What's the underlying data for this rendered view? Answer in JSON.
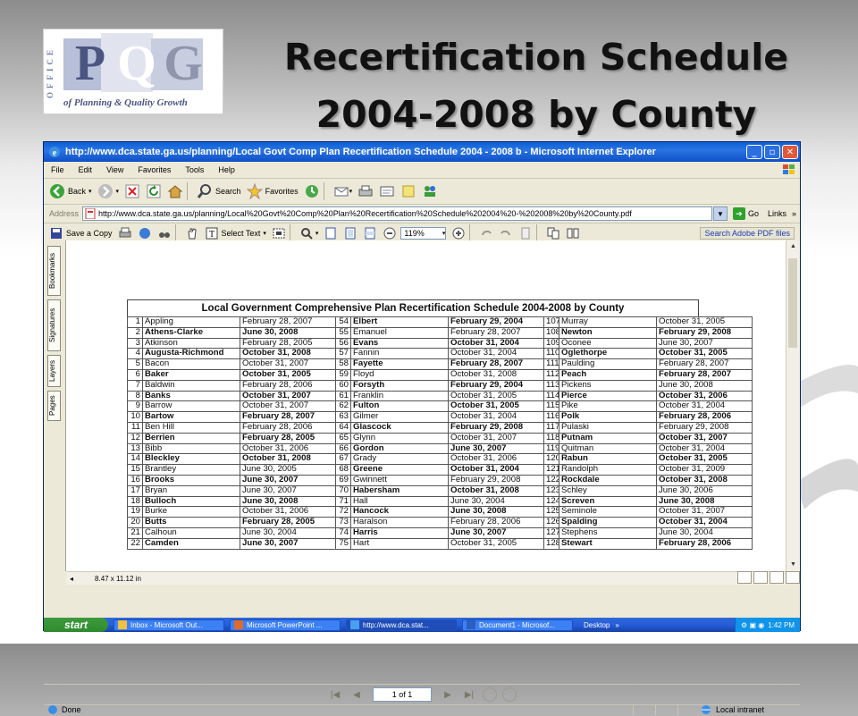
{
  "slide": {
    "title_line1": "Recertification Schedule",
    "title_line2": "2004-2008 by County",
    "logo": {
      "office": "OFFICE",
      "letters": [
        "P",
        "Q",
        "G"
      ],
      "tagline": "of Planning & Quality Growth"
    }
  },
  "browser": {
    "title": "http://www.dca.state.ga.us/planning/Local Govt Comp Plan Recertification Schedule 2004 - 2008 b - Microsoft Internet Explorer",
    "menu": [
      "File",
      "Edit",
      "View",
      "Favorites",
      "Tools",
      "Help"
    ],
    "toolbar": {
      "back": "Back",
      "search": "Search",
      "favorites": "Favorites"
    },
    "address_label": "Address",
    "address_value": "http://www.dca.state.ga.us/planning/Local%20Govt%20Comp%20Plan%20Recertification%20Schedule%202004%20-%202008%20by%20County.pdf",
    "go": "Go",
    "links": "Links"
  },
  "pdf_toolbar": {
    "save_copy": "Save a Copy",
    "select_text": "Select Text",
    "zoom": "119%",
    "search_adobe": "Search Adobe PDF files"
  },
  "side_tabs": [
    "Bookmarks",
    "Signatures",
    "Layers",
    "Pages"
  ],
  "page_size": "8.47 x 11.12 in",
  "page_nav": "1 of 1",
  "status": {
    "left": "Done",
    "zone": "Local intranet"
  },
  "taskbar": {
    "start": "start",
    "tasks": [
      "Inbox - Microsoft Out...",
      "Microsoft PowerPoint ...",
      "http://www.dca.stat...",
      "Document1 - Microsof..."
    ],
    "desktop": "Desktop",
    "clock": "1:42 PM"
  },
  "schedule": {
    "title": "Local Government Comprehensive Plan Recertification Schedule 2004-2008 by County",
    "rows": [
      {
        "b": false,
        "c": [
          [
            "1",
            "Appling",
            "February 28, 2007"
          ],
          [
            "54",
            "Elbert",
            "February 29, 2004"
          ],
          [
            "107",
            "Murray",
            "October 31, 2005"
          ]
        ],
        "bold": [
          false,
          true,
          false
        ]
      },
      {
        "c": [
          [
            "2",
            "Athens-Clarke",
            "June 30, 2008"
          ],
          [
            "55",
            "Emanuel",
            "February 28, 2007"
          ],
          [
            "108",
            "Newton",
            "February 29, 2008"
          ]
        ],
        "bold": [
          true,
          false,
          true
        ]
      },
      {
        "c": [
          [
            "3",
            "Atkinson",
            "February 28, 2005"
          ],
          [
            "56",
            "Evans",
            "October 31, 2004"
          ],
          [
            "109",
            "Oconee",
            "June 30, 2007"
          ]
        ],
        "bold": [
          false,
          true,
          false
        ]
      },
      {
        "c": [
          [
            "4",
            "Augusta-Richmond",
            "October 31, 2008"
          ],
          [
            "57",
            "Fannin",
            "October 31, 2004"
          ],
          [
            "110",
            "Oglethorpe",
            "October 31, 2005"
          ]
        ],
        "bold": [
          true,
          false,
          true
        ]
      },
      {
        "c": [
          [
            "5",
            "Bacon",
            "October 31, 2007"
          ],
          [
            "58",
            "Fayette",
            "February 28, 2007"
          ],
          [
            "111",
            "Paulding",
            "February 28, 2007"
          ]
        ],
        "bold": [
          false,
          true,
          false
        ]
      },
      {
        "c": [
          [
            "6",
            "Baker",
            "October 31, 2005"
          ],
          [
            "59",
            "Floyd",
            "October 31, 2008"
          ],
          [
            "112",
            "Peach",
            "February 28, 2007"
          ]
        ],
        "bold": [
          true,
          false,
          true
        ]
      },
      {
        "c": [
          [
            "7",
            "Baldwin",
            "February 28, 2006"
          ],
          [
            "60",
            "Forsyth",
            "February 29, 2004"
          ],
          [
            "113",
            "Pickens",
            "June 30, 2008"
          ]
        ],
        "bold": [
          false,
          true,
          false
        ]
      },
      {
        "c": [
          [
            "8",
            "Banks",
            "October 31, 2007"
          ],
          [
            "61",
            "Franklin",
            "October 31, 2005"
          ],
          [
            "114",
            "Pierce",
            "October 31, 2006"
          ]
        ],
        "bold": [
          true,
          false,
          true
        ]
      },
      {
        "c": [
          [
            "9",
            "Barrow",
            "October 31, 2007"
          ],
          [
            "62",
            "Fulton",
            "October 31, 2005"
          ],
          [
            "115",
            "Pike",
            "October 31, 2004"
          ]
        ],
        "bold": [
          false,
          true,
          false
        ]
      },
      {
        "c": [
          [
            "10",
            "Bartow",
            "February 28, 2007"
          ],
          [
            "63",
            "Gilmer",
            "October 31, 2004"
          ],
          [
            "116",
            "Polk",
            "February 28, 2006"
          ]
        ],
        "bold": [
          true,
          false,
          true
        ]
      },
      {
        "c": [
          [
            "11",
            "Ben Hill",
            "February 28, 2006"
          ],
          [
            "64",
            "Glascock",
            "February 29, 2008"
          ],
          [
            "117",
            "Pulaski",
            "February 29, 2008"
          ]
        ],
        "bold": [
          false,
          true,
          false
        ]
      },
      {
        "c": [
          [
            "12",
            "Berrien",
            "February 28, 2005"
          ],
          [
            "65",
            "Glynn",
            "October 31, 2007"
          ],
          [
            "118",
            "Putnam",
            "October 31, 2007"
          ]
        ],
        "bold": [
          true,
          false,
          true
        ]
      },
      {
        "c": [
          [
            "13",
            "Bibb",
            "October 31, 2006"
          ],
          [
            "66",
            "Gordon",
            "June 30, 2007"
          ],
          [
            "119",
            "Quitman",
            "October 31, 2004"
          ]
        ],
        "bold": [
          false,
          true,
          false
        ]
      },
      {
        "c": [
          [
            "14",
            "Bleckley",
            "October 31, 2008"
          ],
          [
            "67",
            "Grady",
            "October 31, 2006"
          ],
          [
            "120",
            "Rabun",
            "October 31, 2005"
          ]
        ],
        "bold": [
          true,
          false,
          true
        ]
      },
      {
        "c": [
          [
            "15",
            "Brantley",
            "June 30, 2005"
          ],
          [
            "68",
            "Greene",
            "October 31, 2004"
          ],
          [
            "121",
            "Randolph",
            "October 31, 2009"
          ]
        ],
        "bold": [
          false,
          true,
          false
        ]
      },
      {
        "c": [
          [
            "16",
            "Brooks",
            "June 30, 2007"
          ],
          [
            "69",
            "Gwinnett",
            "February 29, 2008"
          ],
          [
            "122",
            "Rockdale",
            "October 31, 2008"
          ]
        ],
        "bold": [
          true,
          false,
          true
        ]
      },
      {
        "c": [
          [
            "17",
            "Bryan",
            "June 30, 2007"
          ],
          [
            "70",
            "Habersham",
            "October 31, 2008"
          ],
          [
            "123",
            "Schley",
            "June 30, 2006"
          ]
        ],
        "bold": [
          false,
          true,
          false
        ]
      },
      {
        "c": [
          [
            "18",
            "Bulloch",
            "June 30, 2008"
          ],
          [
            "71",
            "Hall",
            "June 30, 2004"
          ],
          [
            "124",
            "Screven",
            "June 30, 2008"
          ]
        ],
        "bold": [
          true,
          false,
          true
        ]
      },
      {
        "c": [
          [
            "19",
            "Burke",
            "October 31, 2006"
          ],
          [
            "72",
            "Hancock",
            "June 30, 2008"
          ],
          [
            "125",
            "Seminole",
            "October 31, 2007"
          ]
        ],
        "bold": [
          false,
          true,
          false
        ]
      },
      {
        "c": [
          [
            "20",
            "Butts",
            "February 28, 2005"
          ],
          [
            "73",
            "Haralson",
            "February 28, 2006"
          ],
          [
            "126",
            "Spalding",
            "October 31, 2004"
          ]
        ],
        "bold": [
          true,
          false,
          true
        ]
      },
      {
        "c": [
          [
            "21",
            "Calhoun",
            "June 30, 2004"
          ],
          [
            "74",
            "Harris",
            "June 30, 2007"
          ],
          [
            "127",
            "Stephens",
            "June 30, 2004"
          ]
        ],
        "bold": [
          false,
          true,
          false
        ]
      },
      {
        "c": [
          [
            "22",
            "Camden",
            "June 30, 2007"
          ],
          [
            "75",
            "Hart",
            "October 31, 2005"
          ],
          [
            "128",
            "Stewart",
            "February 28, 2006"
          ]
        ],
        "bold": [
          true,
          false,
          true
        ]
      }
    ]
  }
}
